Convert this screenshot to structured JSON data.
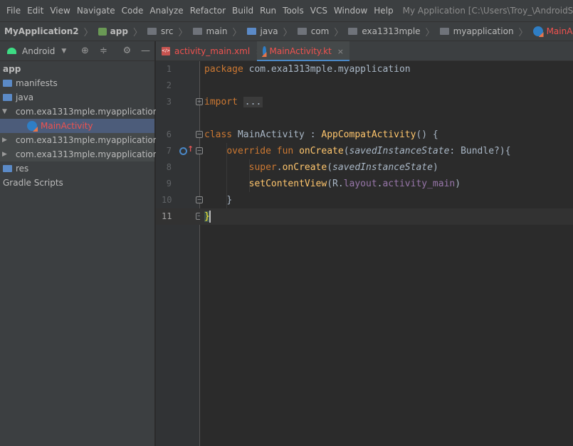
{
  "menubar": {
    "items": [
      "File",
      "Edit",
      "View",
      "Navigate",
      "Code",
      "Analyze",
      "Refactor",
      "Build",
      "Run",
      "Tools",
      "VCS",
      "Window",
      "Help"
    ],
    "mnemonics": [
      "F",
      "E",
      "V",
      "N",
      "C",
      "z",
      "R",
      "B",
      "u",
      "T",
      "S",
      "W",
      "H"
    ],
    "window_title": "My Application [C:\\Users\\Troy_\\AndroidStudi"
  },
  "breadcrumb": {
    "items": [
      "MyApplication2",
      "app",
      "src",
      "main",
      "java",
      "com",
      "exa1313mple",
      "myapplication",
      "MainActivity"
    ]
  },
  "project_panel": {
    "view_label": "Android",
    "tree": [
      {
        "label": "app",
        "level": 0,
        "arrow": "",
        "icon": "none",
        "bold": true
      },
      {
        "label": "manifests",
        "level": 0,
        "arrow": "",
        "icon": "folder"
      },
      {
        "label": "java",
        "level": 0,
        "arrow": "",
        "icon": "folder"
      },
      {
        "label": "com.exa1313mple.myapplication",
        "level": 0,
        "arrow": "▼",
        "icon": "package"
      },
      {
        "label": "MainActivity",
        "level": 1,
        "arrow": "",
        "icon": "kotlin",
        "selected": true
      },
      {
        "label": "com.exa1313mple.myapplication",
        "level": 0,
        "arrow": "▶",
        "icon": "package",
        "gray": true
      },
      {
        "label": "com.exa1313mple.myapplication",
        "level": 0,
        "arrow": "▶",
        "icon": "package",
        "gray": true
      },
      {
        "label": "res",
        "level": 0,
        "arrow": "",
        "icon": "folder"
      },
      {
        "label": "Gradle Scripts",
        "level": 0,
        "arrow": "",
        "icon": "none"
      }
    ]
  },
  "tabs": [
    {
      "label": "activity_main.xml",
      "close": "×",
      "active": false
    },
    {
      "label": "MainActivity.kt",
      "close": "×",
      "active": true
    }
  ],
  "editor": {
    "line_numbers": [
      "1",
      "2",
      "3",
      "6",
      "7",
      "8",
      "9",
      "10",
      "11"
    ],
    "current_line": "11",
    "code": {
      "l1_kw": "package",
      "l1_rest": " com.exa1313mple.myapplication",
      "l3_kw": "import",
      "l3_dots": "...",
      "l6_kw": "class",
      "l6_name": " MainActivity : ",
      "l6_fn": "AppCompatActivity",
      "l6_rest": "() {",
      "l7_kw1": "override",
      "l7_kw2": " fun ",
      "l7_fn": "onCreate",
      "l7_p1": "(",
      "l7_it": "savedInstanceState",
      "l7_rest": ": Bundle?){",
      "l8_kw": "super",
      "l8_dot": ".",
      "l8_fn": "onCreate",
      "l8_p1": "(",
      "l8_it": "savedInstanceState",
      "l8_p2": ")",
      "l9_fn": "setContentView",
      "l9_p1": "(R.",
      "l9_pur1": "layout",
      "l9_dot": ".",
      "l9_pur2": "activity_main",
      "l9_p2": ")",
      "l10": "}",
      "l11": "}"
    }
  },
  "colors": {
    "highlight_red": "#f0524f",
    "annotation_underline": "#e60000",
    "keyword": "#cc7832",
    "function": "#ffc66d",
    "property": "#9876aa"
  }
}
